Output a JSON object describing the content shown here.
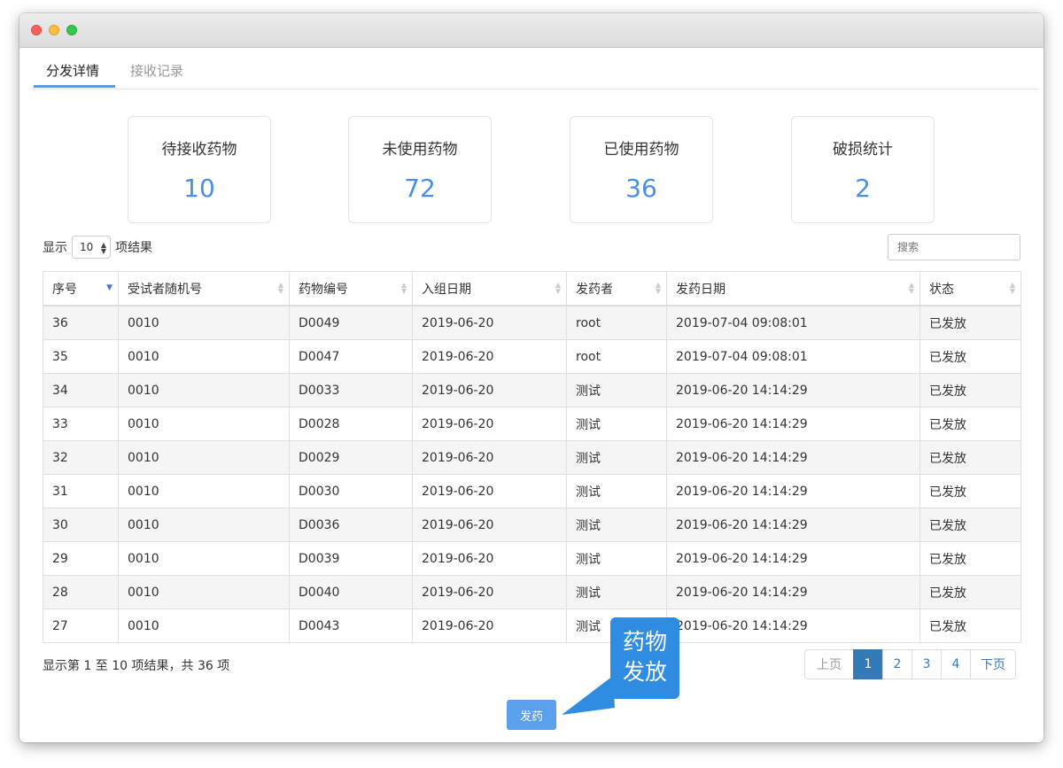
{
  "tabs": [
    {
      "label": "分发详情",
      "active": true
    },
    {
      "label": "接收记录",
      "active": false
    }
  ],
  "stats": [
    {
      "label": "待接收药物",
      "value": "10"
    },
    {
      "label": "未使用药物",
      "value": "72"
    },
    {
      "label": "已使用药物",
      "value": "36"
    },
    {
      "label": "破损统计",
      "value": "2"
    }
  ],
  "length_menu": {
    "prefix": "显示",
    "selected": "10",
    "suffix": "项结果"
  },
  "search": {
    "placeholder": "搜索"
  },
  "table": {
    "columns": [
      "序号",
      "受试者随机号",
      "药物编号",
      "入组日期",
      "发药者",
      "发药日期",
      "状态"
    ],
    "rows": [
      [
        "36",
        "0010",
        "D0049",
        "2019-06-20",
        "root",
        "2019-07-04 09:08:01",
        "已发放"
      ],
      [
        "35",
        "0010",
        "D0047",
        "2019-06-20",
        "root",
        "2019-07-04 09:08:01",
        "已发放"
      ],
      [
        "34",
        "0010",
        "D0033",
        "2019-06-20",
        "测试",
        "2019-06-20 14:14:29",
        "已发放"
      ],
      [
        "33",
        "0010",
        "D0028",
        "2019-06-20",
        "测试",
        "2019-06-20 14:14:29",
        "已发放"
      ],
      [
        "32",
        "0010",
        "D0029",
        "2019-06-20",
        "测试",
        "2019-06-20 14:14:29",
        "已发放"
      ],
      [
        "31",
        "0010",
        "D0030",
        "2019-06-20",
        "测试",
        "2019-06-20 14:14:29",
        "已发放"
      ],
      [
        "30",
        "0010",
        "D0036",
        "2019-06-20",
        "测试",
        "2019-06-20 14:14:29",
        "已发放"
      ],
      [
        "29",
        "0010",
        "D0039",
        "2019-06-20",
        "测试",
        "2019-06-20 14:14:29",
        "已发放"
      ],
      [
        "28",
        "0010",
        "D0040",
        "2019-06-20",
        "测试",
        "2019-06-20 14:14:29",
        "已发放"
      ],
      [
        "27",
        "0010",
        "D0043",
        "2019-06-20",
        "测试",
        "2019-06-20 14:14:29",
        "已发放"
      ]
    ]
  },
  "info_text": "显示第 1 至 10 项结果，共 36 项",
  "pagination": {
    "prev": "上页",
    "pages": [
      "1",
      "2",
      "3",
      "4"
    ],
    "active_page": "1",
    "next": "下页"
  },
  "dispense_button": "发药",
  "callout": {
    "line1": "药物",
    "line2": "发放"
  },
  "colors": {
    "accent": "#4a90e2",
    "callout": "#2f8ce0",
    "active_page": "#337ab7"
  }
}
